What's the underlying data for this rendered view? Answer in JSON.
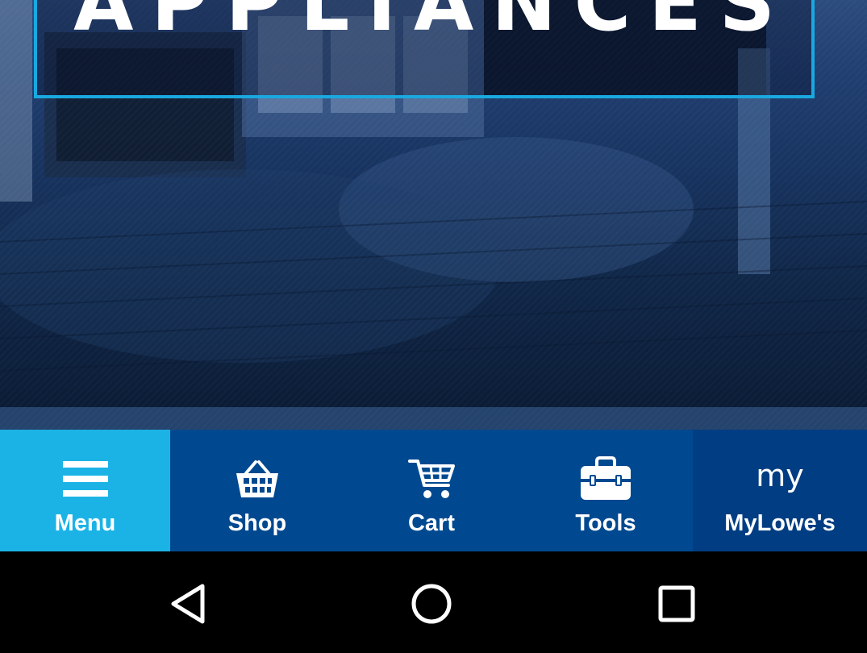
{
  "hero": {
    "title": "APPLIANCES"
  },
  "tabbar": {
    "tabs": [
      {
        "label": "Menu",
        "icon": "hamburger-menu-icon",
        "active": true
      },
      {
        "label": "Shop",
        "icon": "basket-icon"
      },
      {
        "label": "Cart",
        "icon": "shopping-cart-icon"
      },
      {
        "label": "Tools",
        "icon": "toolbox-icon"
      },
      {
        "label": "MyLowe's",
        "icon": "my-logo-icon",
        "icon_text": "my"
      }
    ]
  },
  "navbar": {
    "buttons": [
      "back",
      "home",
      "recent-apps"
    ]
  },
  "colors": {
    "active_tab": "#1bb3e6",
    "tab_bar": "#004990",
    "mylowes_tab": "#003d82",
    "title_border": "#1aa8e0",
    "nav_bar": "#000000"
  }
}
